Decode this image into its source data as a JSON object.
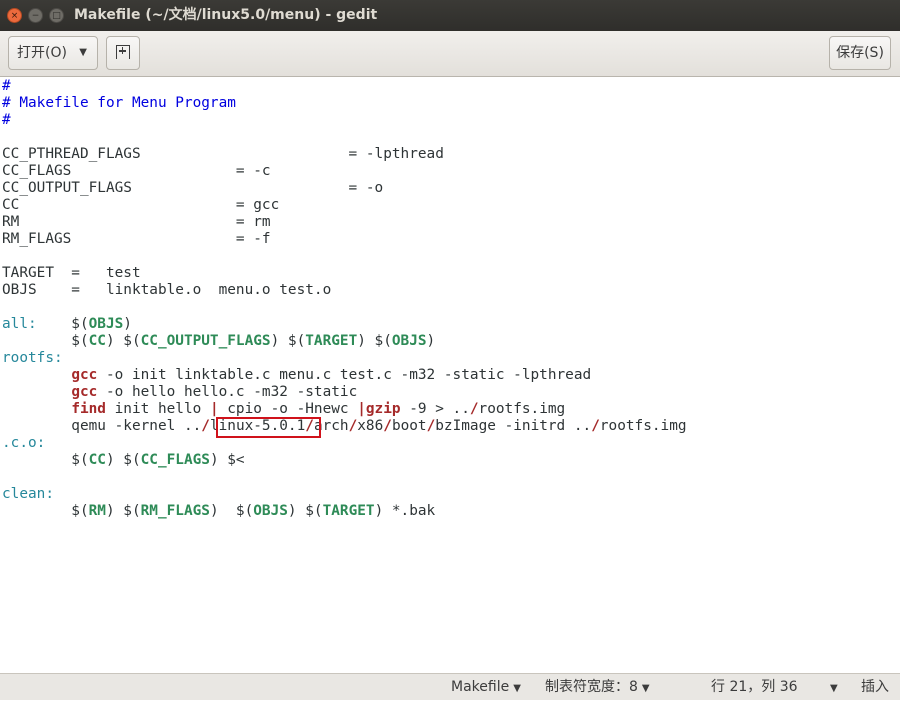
{
  "window": {
    "title": "Makefile (~/文档/linux5.0/menu) - gedit",
    "close_glyph": "×",
    "min_glyph": "−",
    "max_glyph": "□"
  },
  "header": {
    "open_label": "打开(O)",
    "arrow_glyph": "▼",
    "save_label": "保存(S)"
  },
  "editor": {
    "lines": [
      [
        {
          "t": "#",
          "c": "comment"
        }
      ],
      [
        {
          "t": "# Makefile for Menu Program",
          "c": "comment"
        }
      ],
      [
        {
          "t": "#",
          "c": "comment"
        }
      ],
      [],
      [
        {
          "t": "CC_PTHREAD_FLAGS                        = -lpthread"
        }
      ],
      [
        {
          "t": "CC_FLAGS                   = -c"
        }
      ],
      [
        {
          "t": "CC_OUTPUT_FLAGS                         = -o"
        }
      ],
      [
        {
          "t": "CC                         = gcc"
        }
      ],
      [
        {
          "t": "RM                         = rm"
        }
      ],
      [
        {
          "t": "RM_FLAGS                   = -f"
        }
      ],
      [],
      [
        {
          "t": "TARGET  =   test"
        }
      ],
      [
        {
          "t": "OBJS    =   linktable.o  menu.o test.o"
        }
      ],
      [],
      [
        {
          "t": "all:",
          "c": "target"
        },
        {
          "t": "    $("
        },
        {
          "t": "OBJS",
          "c": "var"
        },
        {
          "t": ")"
        }
      ],
      [
        {
          "t": "        $("
        },
        {
          "t": "CC",
          "c": "var"
        },
        {
          "t": ") $("
        },
        {
          "t": "CC_OUTPUT_FLAGS",
          "c": "var"
        },
        {
          "t": ") $("
        },
        {
          "t": "TARGET",
          "c": "var"
        },
        {
          "t": ") $("
        },
        {
          "t": "OBJS",
          "c": "var"
        },
        {
          "t": ")"
        }
      ],
      [
        {
          "t": "rootfs:",
          "c": "target"
        }
      ],
      [
        {
          "t": "        "
        },
        {
          "t": "gcc",
          "c": "kw"
        },
        {
          "t": " -o init linktable.c menu.c test.c -m32 -static -lpthread"
        }
      ],
      [
        {
          "t": "        "
        },
        {
          "t": "gcc",
          "c": "kw"
        },
        {
          "t": " -o hello hello.c -m32 -static"
        }
      ],
      [
        {
          "t": "        "
        },
        {
          "t": "find",
          "c": "kw"
        },
        {
          "t": " init hello "
        },
        {
          "t": "|",
          "c": "kw"
        },
        {
          "t": " cpio -o -Hnewc "
        },
        {
          "t": "|gzip",
          "c": "kw"
        },
        {
          "t": " -9 > .."
        },
        {
          "t": "/",
          "c": "kw"
        },
        {
          "t": "rootfs.img"
        }
      ],
      [
        {
          "t": "        qemu -kernel .."
        },
        {
          "t": "/",
          "c": "kw"
        },
        {
          "t": "linux-5.0.1"
        },
        {
          "t": "/",
          "c": "kw"
        },
        {
          "t": "arch"
        },
        {
          "t": "/",
          "c": "kw"
        },
        {
          "t": "x86"
        },
        {
          "t": "/",
          "c": "kw"
        },
        {
          "t": "boot"
        },
        {
          "t": "/",
          "c": "kw"
        },
        {
          "t": "bzImage -initrd .."
        },
        {
          "t": "/",
          "c": "kw"
        },
        {
          "t": "rootfs.img"
        }
      ],
      [
        {
          "t": ".c.o:",
          "c": "target"
        }
      ],
      [
        {
          "t": "        $("
        },
        {
          "t": "CC",
          "c": "var"
        },
        {
          "t": ") $("
        },
        {
          "t": "CC_FLAGS",
          "c": "var"
        },
        {
          "t": ") $<"
        }
      ],
      [],
      [
        {
          "t": "clean:",
          "c": "target"
        }
      ],
      [
        {
          "t": "        $("
        },
        {
          "t": "RM",
          "c": "var"
        },
        {
          "t": ") $("
        },
        {
          "t": "RM_FLAGS",
          "c": "var"
        },
        {
          "t": ")  $("
        },
        {
          "t": "OBJS",
          "c": "var"
        },
        {
          "t": ") $("
        },
        {
          "t": "TARGET",
          "c": "var"
        },
        {
          "t": ") *.bak"
        }
      ]
    ],
    "highlight_color": "#d0121b"
  },
  "status": {
    "language": "Makefile",
    "tab_width": "制表符宽度：8",
    "position": "行 21，列 36",
    "mode": "插入"
  }
}
